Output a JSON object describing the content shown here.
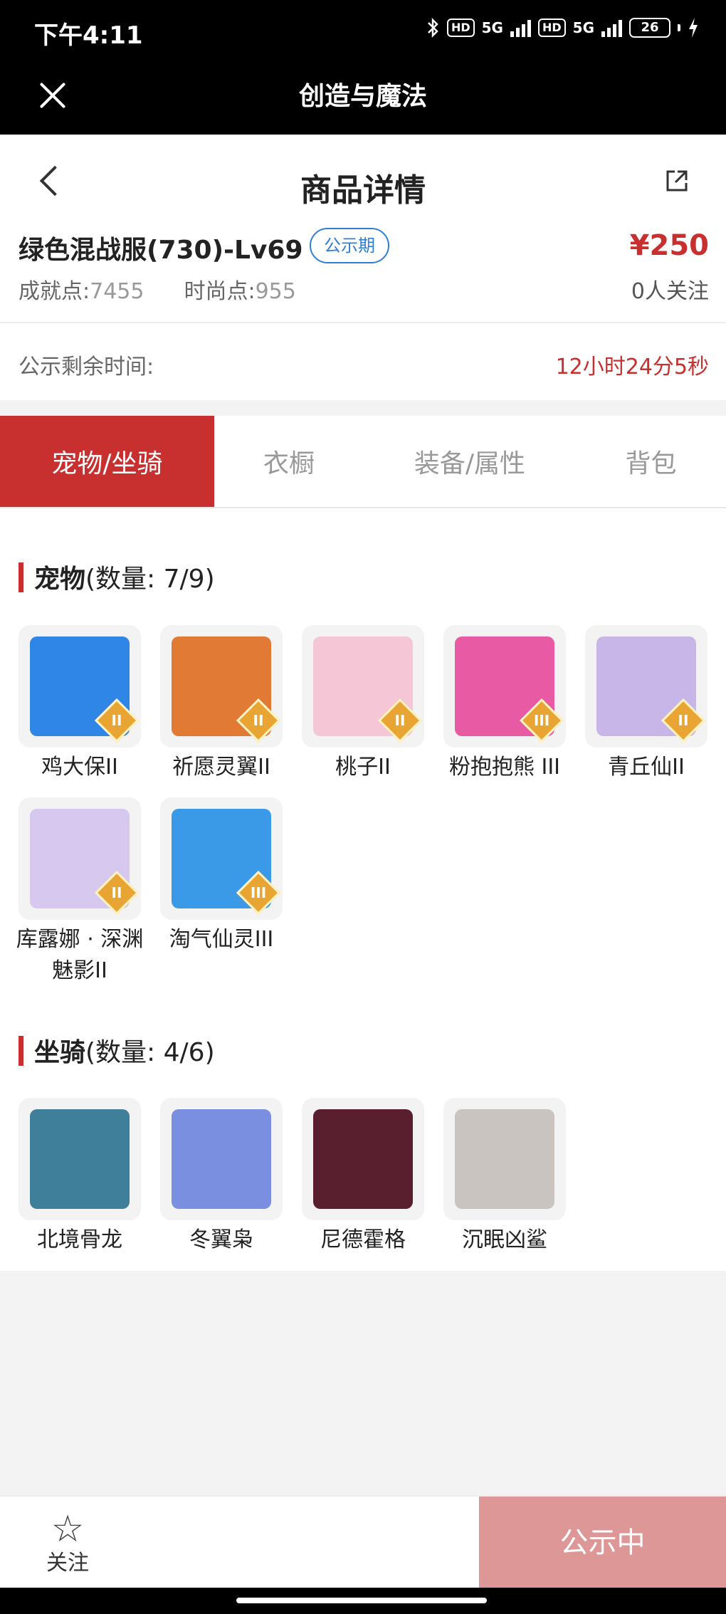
{
  "status_bar": {
    "time": "下午4:11",
    "hd1": "HD",
    "net1": "5G",
    "hd2": "HD",
    "net2": "5G",
    "battery": "26",
    "battery_color": "#3bd46b"
  },
  "app_bar": {
    "title": "创造与魔法",
    "close_icon": "close-icon"
  },
  "nav": {
    "title": "商品详情",
    "back_icon": "chevron-left-icon",
    "share_icon": "share-icon"
  },
  "item": {
    "name": "绿色混战服(730)-Lv69",
    "badge": "公示期",
    "price": "¥250",
    "achievement_label": "成就点:",
    "achievement_value": "7455",
    "fashion_label": "时尚点:",
    "fashion_value": "955",
    "followers": "0人关注"
  },
  "countdown": {
    "label": "公示剩余时间:",
    "value": "12小时24分5秒"
  },
  "tabs": [
    {
      "label": "宠物/坐骑",
      "active": true
    },
    {
      "label": "衣橱",
      "active": false
    },
    {
      "label": "装备/属性",
      "active": false
    },
    {
      "label": "背包",
      "active": false
    }
  ],
  "pets": {
    "title": "宠物",
    "count": "(数量: 7/9)",
    "items": [
      {
        "name": "鸡大保II",
        "rank": "II",
        "color": "#2f86e6"
      },
      {
        "name": "祈愿灵翼II",
        "rank": "II",
        "color": "#e07a35"
      },
      {
        "name": "桃子II",
        "rank": "II",
        "color": "#f5c6d6"
      },
      {
        "name": "粉抱抱熊 III",
        "rank": "III",
        "color": "#e85aa4"
      },
      {
        "name": "青丘仙II",
        "rank": "II",
        "color": "#c9b6e8"
      },
      {
        "name": "库露娜 · 深渊魅影II",
        "rank": "II",
        "color": "#d7c8ef"
      },
      {
        "name": "淘气仙灵III",
        "rank": "III",
        "color": "#3a9ae8"
      }
    ]
  },
  "mounts": {
    "title": "坐骑",
    "count": "(数量: 4/6)",
    "items": [
      {
        "name": "北境骨龙",
        "color": "#3f7f9a"
      },
      {
        "name": "冬翼枭",
        "color": "#7a8fe0"
      },
      {
        "name": "尼德霍格",
        "color": "#5a1f2e"
      },
      {
        "name": "沉眠凶鲨",
        "color": "#c9c4c0"
      }
    ]
  },
  "bottom": {
    "follow_label": "关注",
    "status_label": "公示中",
    "star_icon": "star-icon"
  },
  "accent": "#c8302f"
}
